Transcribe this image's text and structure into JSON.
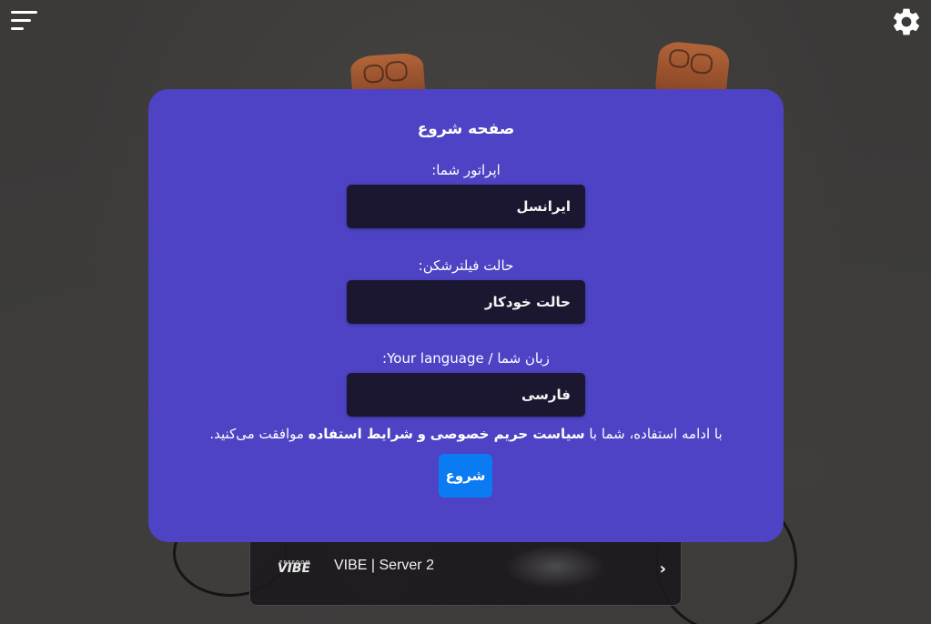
{
  "modal": {
    "title": "صفحه شروع",
    "operator": {
      "label": "اپراتور شما:",
      "value": "ایرانسل"
    },
    "vpn_mode": {
      "label": "حالت فیلترشکن:",
      "value": "حالت خودکار"
    },
    "language": {
      "label": "زبان شما / Your language:",
      "value": "فارسی"
    },
    "consent": {
      "prefix": "با ادامه استفاده، شما با",
      "privacy_link": "سیاست حریم خصوصی",
      "conjunction": "و",
      "terms_link": "شرایط استفاده",
      "suffix": "موافقت می‌کنید."
    },
    "start_button": "شروع"
  },
  "server_card": {
    "logo_small": "FREEDOM",
    "logo": "VIBE",
    "name": "VIBE | Server 2",
    "chevron": "›"
  },
  "icons": {
    "menu": "menu-icon",
    "settings": "gear-icon"
  },
  "colors": {
    "modal_bg": "#4d43c4",
    "input_bg": "#1b1730",
    "primary_button": "#0b7bf2",
    "page_bg": "#3b3a39"
  }
}
